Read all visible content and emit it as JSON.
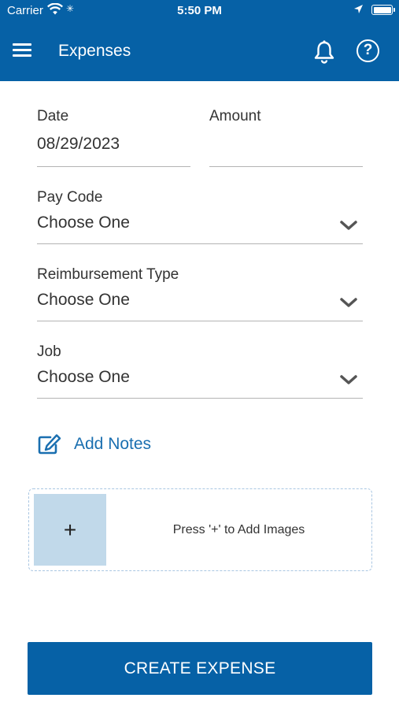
{
  "status_bar": {
    "carrier": "Carrier",
    "time": "5:50 PM"
  },
  "header": {
    "title": "Expenses"
  },
  "form": {
    "date": {
      "label": "Date",
      "value": "08/29/2023"
    },
    "amount": {
      "label": "Amount",
      "value": ""
    },
    "pay_code": {
      "label": "Pay Code",
      "value": "Choose One"
    },
    "reimbursement_type": {
      "label": "Reimbursement Type",
      "value": "Choose One"
    },
    "job": {
      "label": "Job",
      "value": "Choose One"
    }
  },
  "notes": {
    "label": "Add Notes"
  },
  "images": {
    "add_symbol": "+",
    "hint": "Press '+' to Add Images"
  },
  "actions": {
    "create_label": "CREATE EXPENSE"
  },
  "colors": {
    "brand": "#0661a6",
    "link": "#1a6fb0",
    "image_box": "#c1d9ea"
  }
}
